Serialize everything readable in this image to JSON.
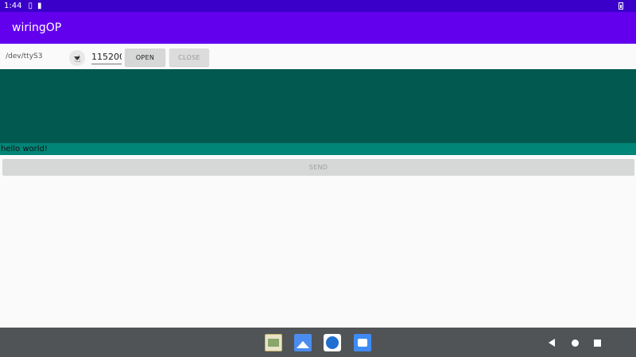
{
  "status_bar": {
    "time": "1:44",
    "icons": [
      "sim-icon",
      "sd-card-icon",
      "battery-icon"
    ]
  },
  "app_bar": {
    "title": "wiringOP"
  },
  "controls": {
    "device_path": "/dev/ttyS3",
    "baud_rate": "115200",
    "open_label": "OPEN",
    "close_label": "CLOSE"
  },
  "send": {
    "text": "hello world!",
    "send_label": "SEND"
  },
  "colors": {
    "status_bar": "#3a00c9",
    "app_bar": "#6200ee",
    "receive_area": "#01594f",
    "send_field": "#008577",
    "nav_bar": "#505456"
  },
  "dock": {
    "apps": [
      "file-manager-icon",
      "gallery-icon",
      "browser-icon",
      "camera-icon"
    ]
  }
}
